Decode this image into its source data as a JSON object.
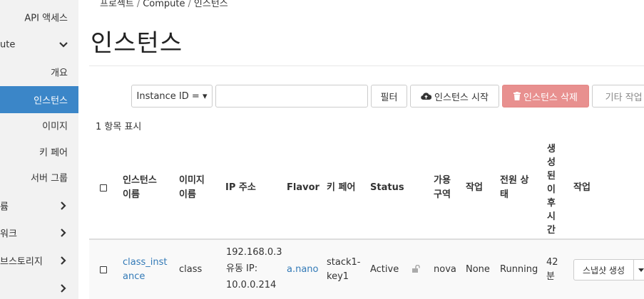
{
  "sidebar": {
    "api_access": "API 액세스",
    "compute": "ute",
    "overview": "개요",
    "instances": "인스턴스",
    "images": "이미지",
    "keypairs": "키 페어",
    "server_groups": "서버 그룹",
    "section_a": "륨",
    "section_b": "워크",
    "section_c": "브스토리지",
    "section_d": ""
  },
  "breadcrumb": {
    "item1": "프로젝트",
    "item2": "Compute",
    "item3": "인스턴스"
  },
  "page_title": "인스턴스",
  "toolbar": {
    "filter_select": "Instance ID = ▾",
    "search_value": "",
    "filter_button": "필터",
    "launch_button": "인스턴스 시작",
    "delete_button": "인스턴스 삭제",
    "more_actions": "기타 작업 ▾"
  },
  "items_count": "1 항목 표시",
  "table": {
    "headers": {
      "name_1": "인스턴스",
      "name_2": "이름",
      "image_1": "이미지",
      "image_2": "이름",
      "ip": "IP 주소",
      "flavor": "Flavor",
      "keypair": "키 페어",
      "status": "Status",
      "az_1": "가용",
      "az_2": "구역",
      "task": "작업",
      "power_1": "전원 상",
      "power_2": "태",
      "age": [
        "생",
        "성",
        "된",
        "이",
        "후",
        "시",
        "간"
      ],
      "actions": "작업"
    },
    "row": {
      "name_1": "class_inst",
      "name_2": "ance",
      "image": "class",
      "ip_1": "192.168.0.3",
      "ip_2": "유동 IP:",
      "ip_3": "10.0.0.214",
      "flavor": "a.nano",
      "keypair_1": "stack1-",
      "keypair_2": "key1",
      "status": "Active",
      "az": "nova",
      "task": "None",
      "power": "Running",
      "age_1": "42",
      "age_2": "분",
      "action_button": "스냅샷 생성"
    }
  }
}
